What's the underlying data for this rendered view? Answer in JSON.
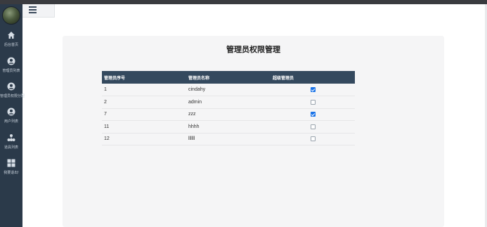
{
  "colors": {
    "sidebar_bg": "#2b3a4a",
    "table_header_bg": "#34495e",
    "checkbox_checked": "#1a73e8"
  },
  "sidebar": {
    "items": [
      {
        "label": "后台首页",
        "icon": "home-icon"
      },
      {
        "label": "管理员列表",
        "icon": "user-circle-icon"
      },
      {
        "label": "管理员权限分配",
        "icon": "user-circle-icon"
      },
      {
        "label": "用户列表",
        "icon": "user-circle-icon"
      },
      {
        "label": "道具列表",
        "icon": "sitemap-icon"
      },
      {
        "label": "我要退出!",
        "icon": "grid-icon"
      }
    ]
  },
  "panel": {
    "title": "管理员权限管理"
  },
  "table": {
    "headers": [
      "管理员序号",
      "管理员名称",
      "超级管理员"
    ],
    "rows": [
      {
        "id": "1",
        "name": "cindahy",
        "super": true
      },
      {
        "id": "2",
        "name": "admin",
        "super": false
      },
      {
        "id": "7",
        "name": "zzz",
        "super": true
      },
      {
        "id": "11",
        "name": "hhhh",
        "super": false
      },
      {
        "id": "12",
        "name": "llllll",
        "super": false
      }
    ]
  }
}
